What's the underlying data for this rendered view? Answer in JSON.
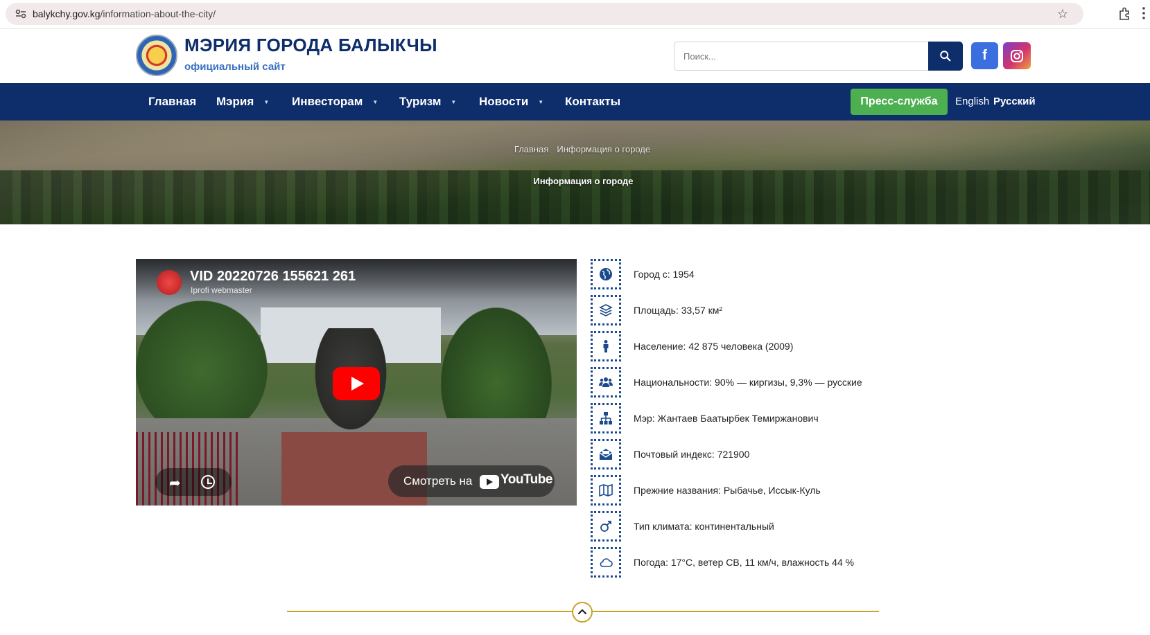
{
  "browser": {
    "url_host": "balykchy.gov.kg",
    "url_path": "/information-about-the-city/"
  },
  "header": {
    "title": "МЭРИЯ ГОРОДА БАЛЫКЧЫ",
    "subtitle": "официальный сайт",
    "search_placeholder": "Поиск..."
  },
  "nav": {
    "items": [
      {
        "label": "Главная",
        "has_dropdown": false
      },
      {
        "label": "Мэрия",
        "has_dropdown": true
      },
      {
        "label": "Инвесторам",
        "has_dropdown": true
      },
      {
        "label": "Туризм",
        "has_dropdown": true
      },
      {
        "label": "Новости",
        "has_dropdown": true
      },
      {
        "label": "Контакты",
        "has_dropdown": false
      }
    ],
    "press_button": "Пресс-служба",
    "languages": [
      "English",
      "Русский"
    ],
    "active_language": "Русский"
  },
  "hero": {
    "breadcrumb": [
      "Главная",
      "Информация о городе"
    ],
    "title": "Информация о городе"
  },
  "video": {
    "title": "VID 20220726 155621 261",
    "channel": "Iprofi webmaster",
    "watch_label": "Смотреть на",
    "youtube_word": "YouTube"
  },
  "info": [
    {
      "icon": "globe-icon",
      "text": "Город с: 1954"
    },
    {
      "icon": "layers-icon",
      "text": "Площадь: 33,57 км²"
    },
    {
      "icon": "person-icon",
      "text": "Население: 42 875 человека (2009)"
    },
    {
      "icon": "users-icon",
      "text": "Национальности: 90% — киргизы, 9,3% — русские"
    },
    {
      "icon": "sitemap-icon",
      "text": "Мэр: Жантаев Баатырбек Темиржанович"
    },
    {
      "icon": "mail-icon",
      "text": "Почтовый индекс: 721900"
    },
    {
      "icon": "map-icon",
      "text": "Прежние названия: Рыбачье, Иссык-Куль"
    },
    {
      "icon": "climate-icon",
      "text": "Тип климата: континентальный"
    },
    {
      "icon": "cloud-icon",
      "text": "Погода: 17°C, ветер СВ, 11 км/ч, влажность 44 %"
    }
  ],
  "colors": {
    "nav_bg": "#0d2d6b",
    "press_green": "#4caf50",
    "accent_gold": "#c9a227",
    "icon_blue": "#1b4a8d"
  }
}
